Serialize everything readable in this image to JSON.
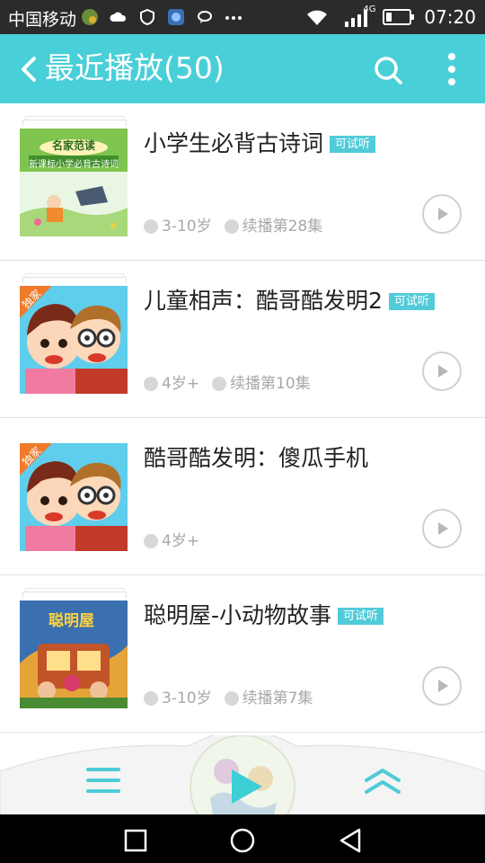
{
  "status_bar": {
    "carrier": "中国移动",
    "network": "4G",
    "time": "07:20",
    "icons": [
      "map-icon",
      "cloud-icon",
      "shield-icon",
      "app-icon",
      "chat-icon",
      "more-dots-icon",
      "wifi-icon",
      "signal-icon",
      "battery-icon"
    ]
  },
  "app_bar": {
    "title": "最近播放(50)",
    "background": "#49cfd8",
    "icons": [
      "back-arrow-icon",
      "search-icon",
      "more-vertical-icon"
    ]
  },
  "items": [
    {
      "title": "小学生必背古诗词",
      "badge": "可试听",
      "age": "3-10岁",
      "progress": "续播第28集",
      "cover_title": "名家范读",
      "cover_subtitle": "新课标小学必背古诗词"
    },
    {
      "title": "儿童相声：酷哥酷发明2",
      "badge": "可试听",
      "age": "4岁+",
      "progress": "续播第10集",
      "corner_tag": "独家"
    },
    {
      "title": "酷哥酷发明：傻瓜手机",
      "badge": "",
      "age": "4岁+",
      "progress": "",
      "corner_tag": "独家"
    },
    {
      "title": "聪明屋-小动物故事",
      "badge": "可试听",
      "age": "3-10岁",
      "progress": "续播第7集",
      "cover_title": "聪明屋"
    }
  ],
  "player": {
    "icons": [
      "menu-icon",
      "play-icon",
      "double-chevron-up-icon"
    ]
  },
  "nav_bar": {
    "icons": [
      "recent-apps-icon",
      "home-icon",
      "back-triangle-icon"
    ]
  },
  "colors": {
    "accent": "#49cfd8",
    "badge": "#52cbd9",
    "meta_text": "#a8a8a8"
  }
}
